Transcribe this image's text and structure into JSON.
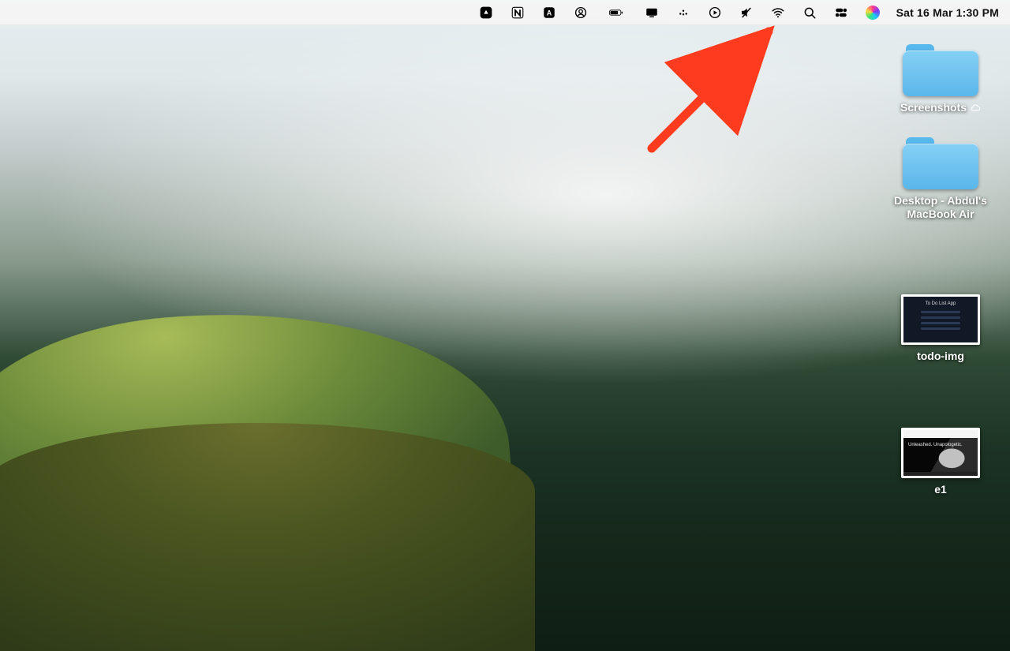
{
  "menubar": {
    "icons": [
      {
        "name": "google-drive-icon"
      },
      {
        "name": "notion-icon"
      },
      {
        "name": "app-a-icon"
      },
      {
        "name": "user-circle-icon"
      },
      {
        "name": "battery-icon"
      },
      {
        "name": "display-icon"
      },
      {
        "name": "menu-extra-dots-icon"
      },
      {
        "name": "now-playing-icon"
      },
      {
        "name": "sound-muted-icon"
      },
      {
        "name": "wifi-icon"
      },
      {
        "name": "spotlight-search-icon"
      },
      {
        "name": "control-center-icon"
      },
      {
        "name": "siri-icon"
      }
    ],
    "clock": "Sat 16 Mar  1:30 PM"
  },
  "annotation": {
    "target": "siri-icon",
    "color": "#ff3b1f"
  },
  "desktop": {
    "items": [
      {
        "type": "folder",
        "label": "Screenshots",
        "cloud": true
      },
      {
        "type": "folder",
        "label": "Desktop - Abdul's MacBook Air",
        "cloud": false
      },
      {
        "type": "image",
        "label": "todo-img",
        "thumb": "todo"
      },
      {
        "type": "image",
        "label": "e1",
        "thumb": "e1"
      }
    ]
  },
  "thumbnails": {
    "todo_title": "To Do List App"
  }
}
